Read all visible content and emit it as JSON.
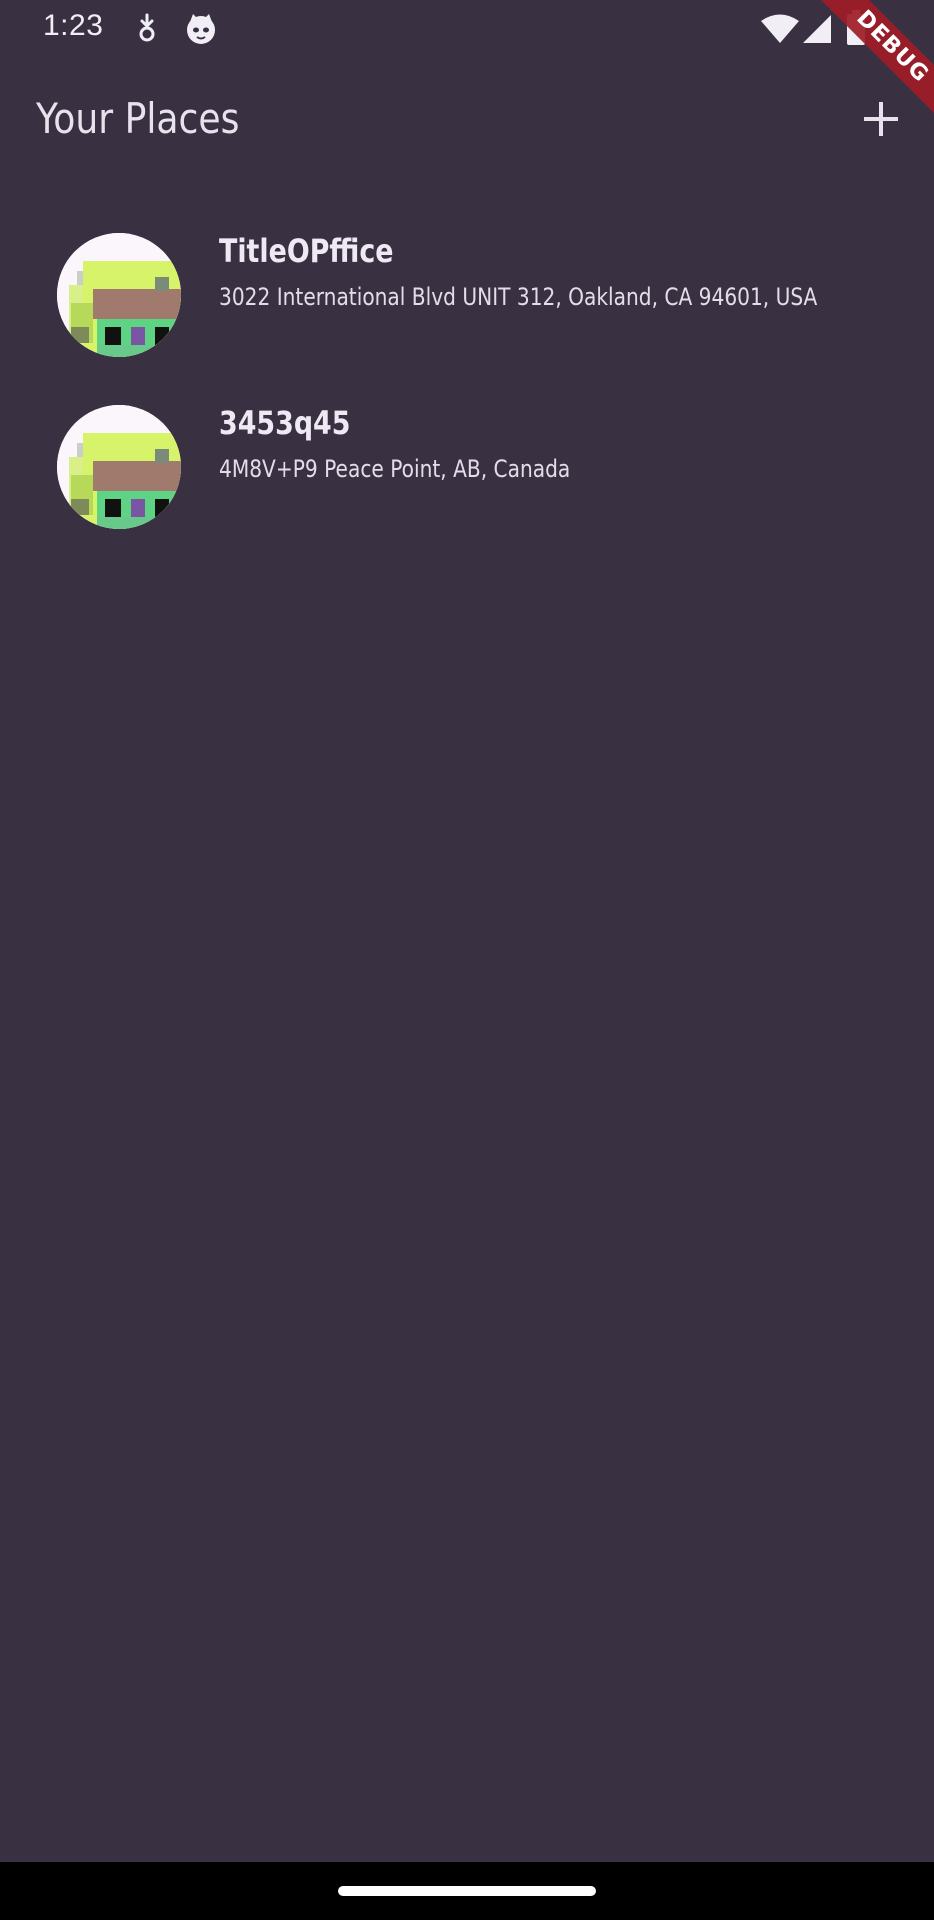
{
  "status_bar": {
    "time": "1:23",
    "icons": [
      "download-notification-icon",
      "cat-face-icon",
      "wifi-icon",
      "cellular-signal-icon",
      "battery-icon"
    ]
  },
  "debug_banner": {
    "label": "DEBUG",
    "color": "#a01b26"
  },
  "app_bar": {
    "title": "Your Places",
    "action_icon": "plus-icon"
  },
  "places": [
    {
      "title": "TitleOPffice",
      "address": "3022 International Blvd UNIT 312, Oakland, CA 94601, USA",
      "thumbnail_icon": "pixel-house-thumbnail"
    },
    {
      "title": "3453q45",
      "address": "4M8V+P9 Peace Point, AB, Canada",
      "thumbnail_icon": "pixel-house-thumbnail"
    }
  ],
  "theme": {
    "background": "#393142",
    "text": "#efe9f4"
  }
}
